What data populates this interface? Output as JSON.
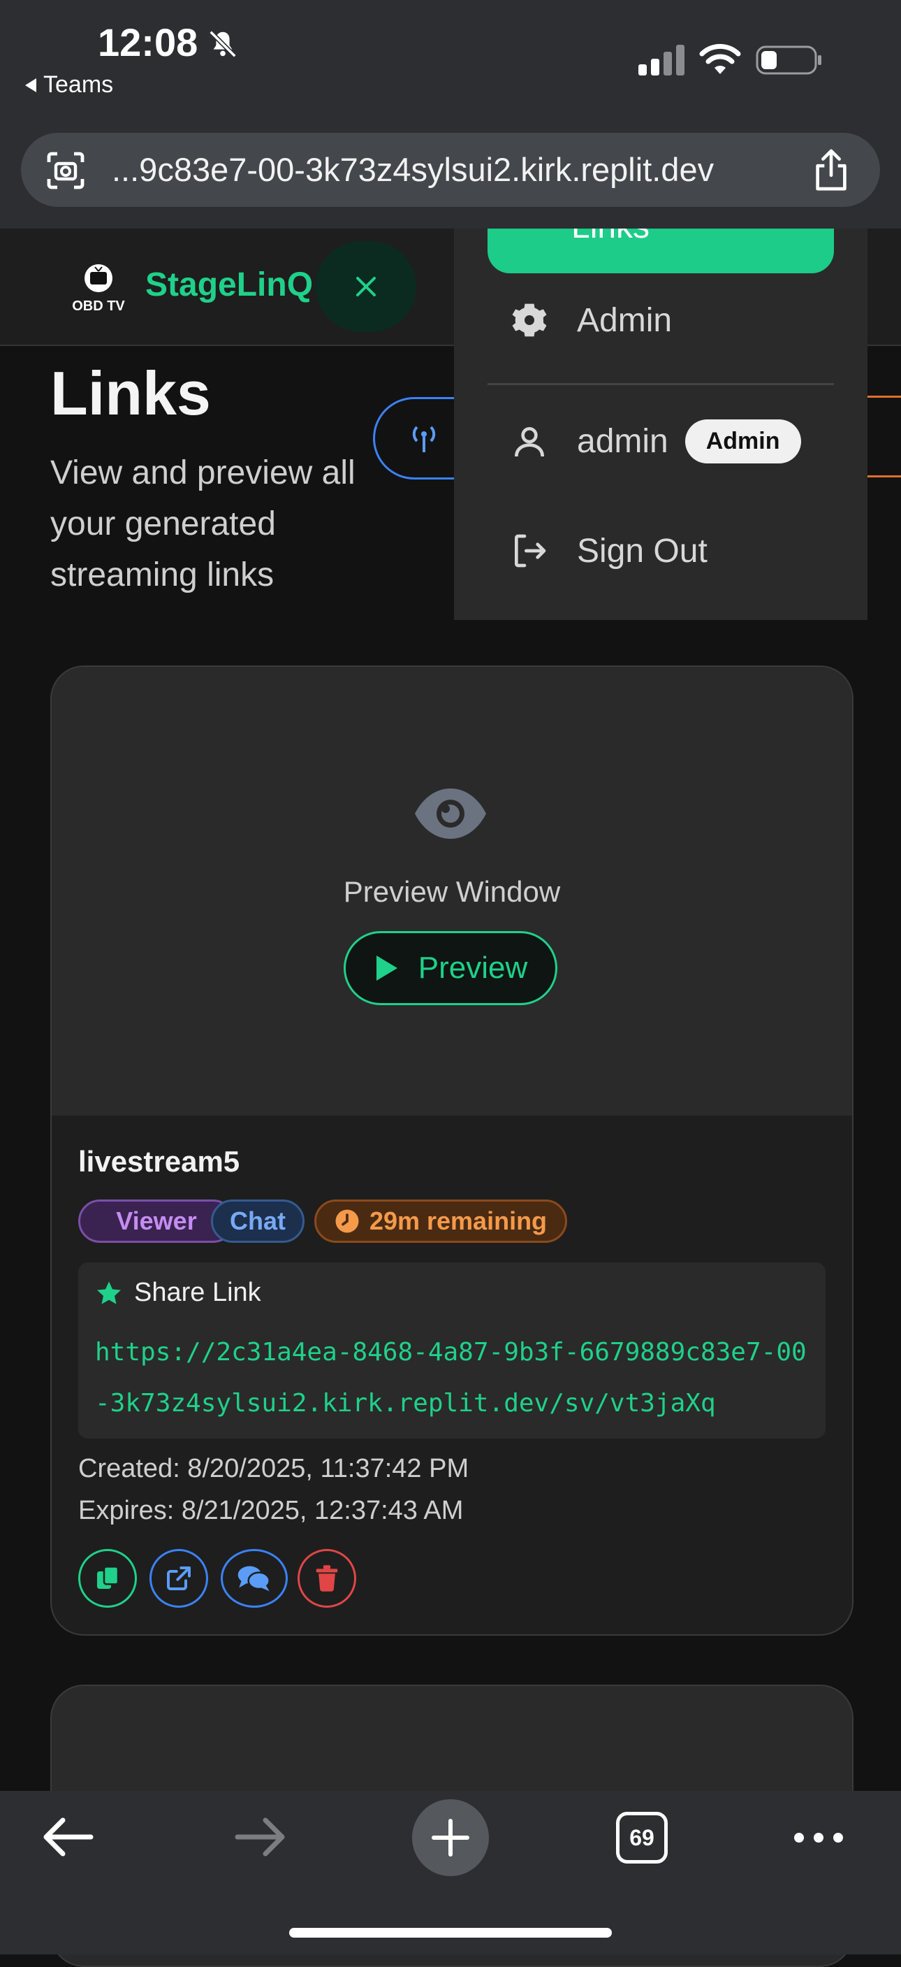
{
  "status_bar": {
    "time": "12:08",
    "back_app": "Teams"
  },
  "browser": {
    "url": "...9c83e7-00-3k73z4sylsui2.kirk.replit.dev",
    "tabs_count": "69"
  },
  "header": {
    "brand": "StageLinQ",
    "logo_text": "OBD TV",
    "brand_color": "#1fd18a"
  },
  "page": {
    "title": "Links",
    "subtitle": "View and preview all your generated streaming links"
  },
  "menu": {
    "links_label": "Links",
    "admin_label": "Admin",
    "user_name": "admin",
    "user_role": "Admin",
    "sign_out": "Sign Out"
  },
  "card": {
    "preview_window": "Preview Window",
    "preview_button": "Preview",
    "stream_name": "livestream5",
    "badges": {
      "viewer": "Viewer",
      "chat": "Chat",
      "time_remaining": "29m remaining"
    },
    "share_title": "Share Link",
    "share_url": "https://2c31a4ea-8468-4a87-9b3f-6679889c83e7-00-3k73z4sylsui2.kirk.replit.dev/sv/vt3jaXq",
    "created": "Created: 8/20/2025, 11:37:42 PM",
    "expires": "Expires: 8/21/2025, 12:37:43 AM"
  },
  "colors": {
    "accent_green": "#1fd18a",
    "blue": "#3b82f6",
    "red": "#e04646",
    "orange": "#f49a4a",
    "purple": "#c58cf2"
  }
}
